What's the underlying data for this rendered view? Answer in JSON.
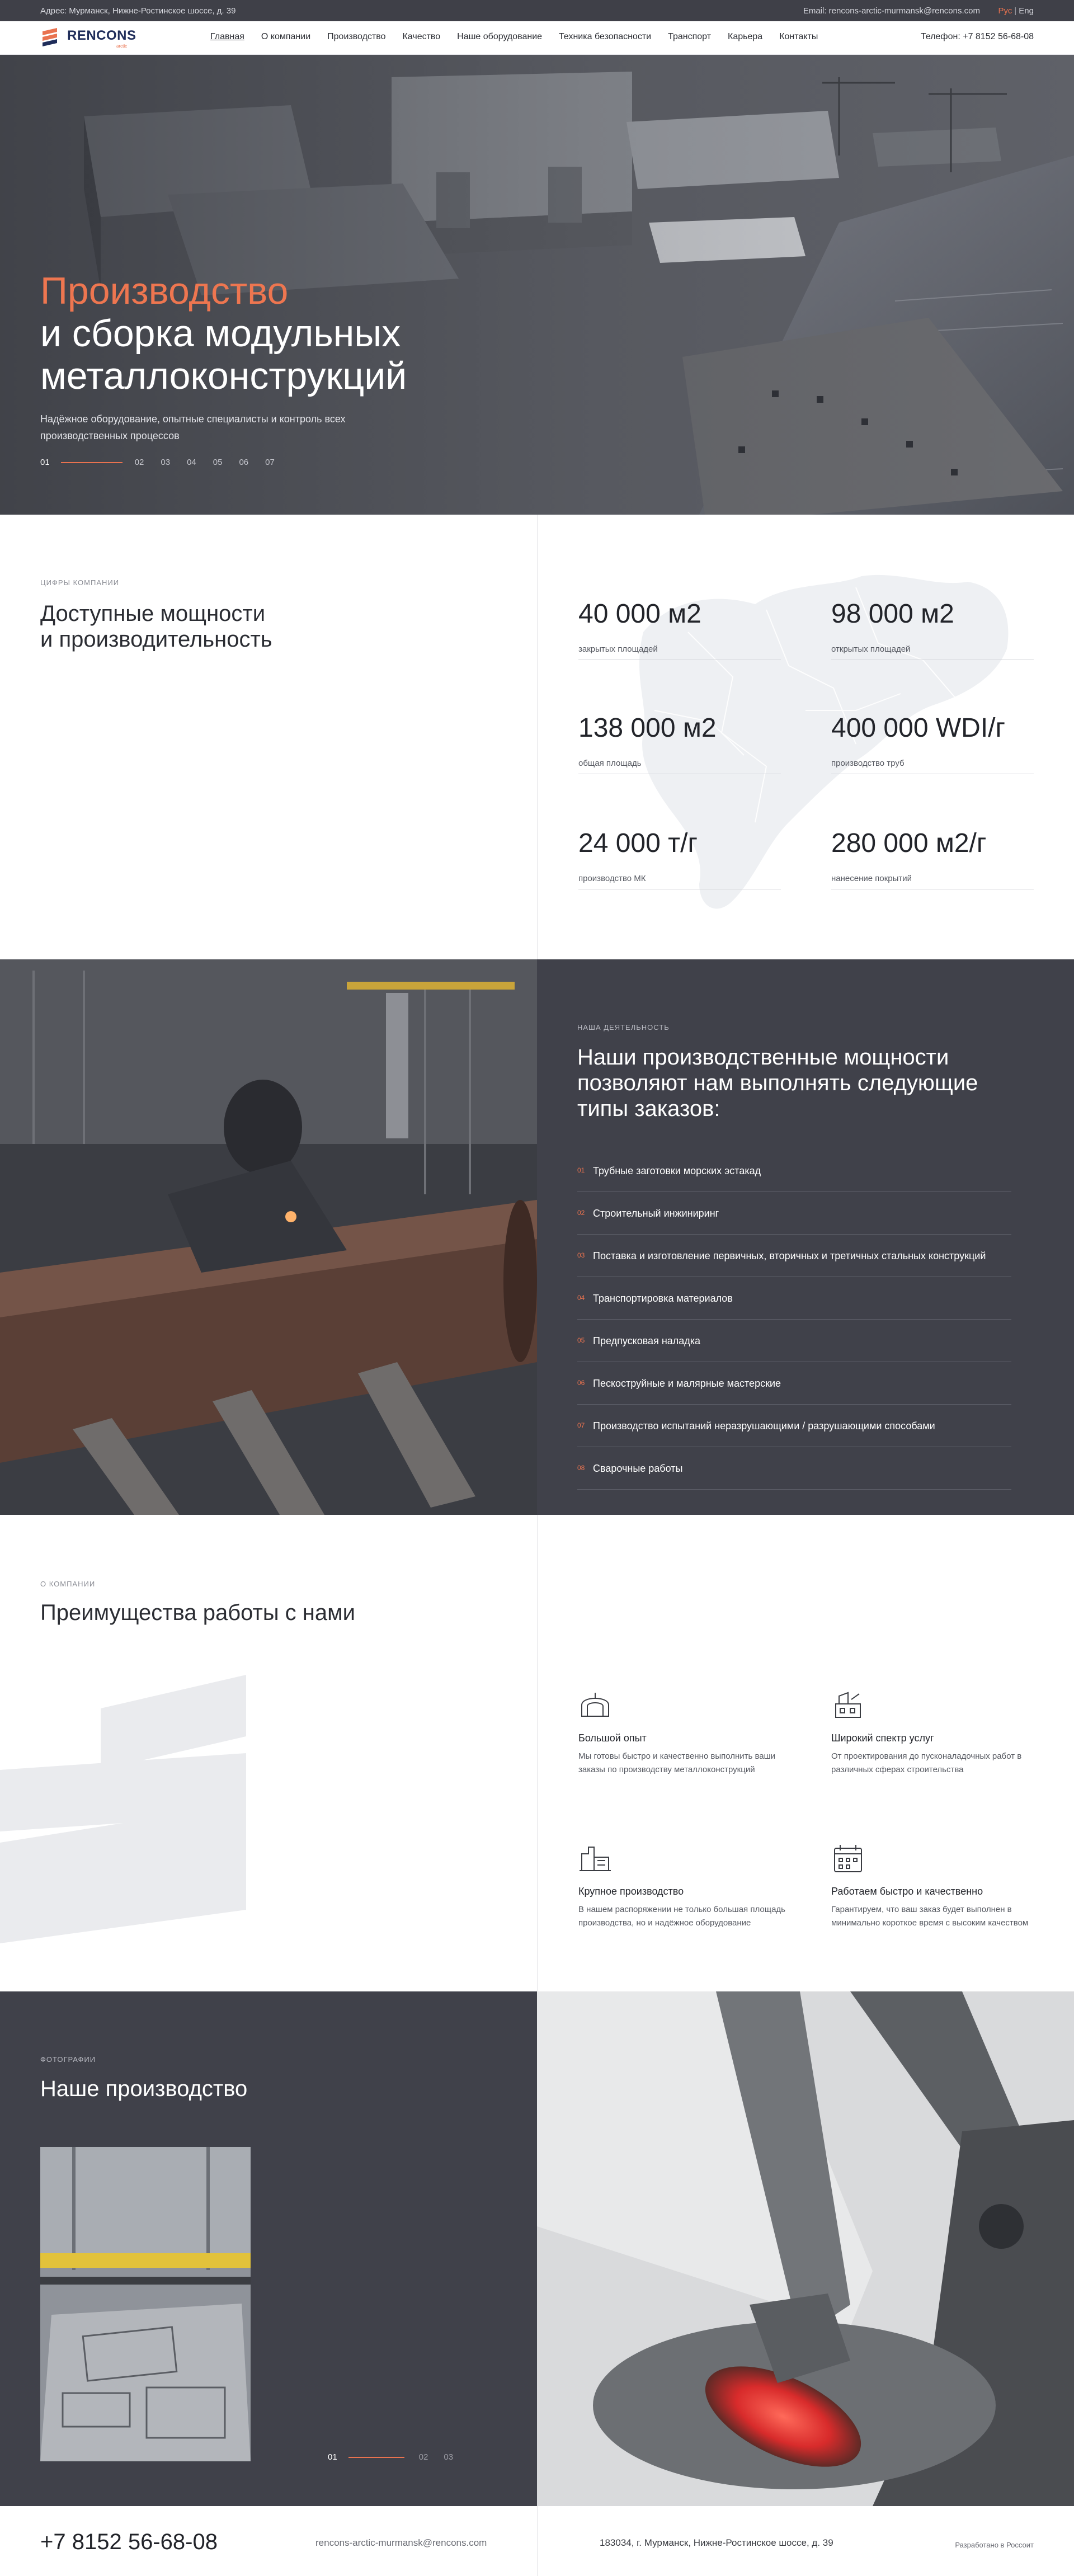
{
  "topbar": {
    "address": "Адрес: Мурманск, Нижне-Ростинское шоссе, д. 39",
    "email": "Email: rencons-arctic-murmansk@rencons.com",
    "lang_ru": "Рус",
    "lang_sep": "|",
    "lang_en": "Eng"
  },
  "header": {
    "logo_name": "RENCONS",
    "logo_sub": "arctic",
    "nav": [
      "Главная",
      "О компании",
      "Производство",
      "Качество",
      "Наше оборудование",
      "Техника безопасности",
      "Транспорт",
      "Карьера",
      "Контакты"
    ],
    "phone": "Телефон: +7 8152 56-68-08"
  },
  "hero": {
    "title_accent": "Производство",
    "title_line2": "и сборка модульных",
    "title_line3": "металлоконструкций",
    "subtitle": "Надёжное оборудование, опытные специалисты и контроль всех производственных процессов",
    "slides": [
      "01",
      "02",
      "03",
      "04",
      "05",
      "06",
      "07"
    ],
    "active_slide": "01"
  },
  "stats": {
    "eyebrow": "ЦИФРЫ КОМПАНИИ",
    "title_line1": "Доступные мощности",
    "title_line2": "и производительность",
    "items": [
      {
        "value": "40 000 м2",
        "label": "закрытых площадей"
      },
      {
        "value": "98 000 м2",
        "label": "открытых площадей"
      },
      {
        "value": "138 000 м2",
        "label": "общая площадь"
      },
      {
        "value": "400 000 WDI/г",
        "label": "производство труб"
      },
      {
        "value": "24 000 т/г",
        "label": "производство МК"
      },
      {
        "value": "280 000 м2/г",
        "label": "нанесение покрытий"
      }
    ]
  },
  "activity": {
    "eyebrow": "НАША ДЕЯТЕЛЬНОСТЬ",
    "title": "Наши производственные мощности позволяют нам выполнять следующие типы заказов:",
    "items": [
      {
        "n": "01",
        "text": "Трубные заготовки морских эстакад"
      },
      {
        "n": "02",
        "text": "Строительный инжиниринг"
      },
      {
        "n": "03",
        "text": "Поставка и изготовление первичных, вторичных и третичных стальных конструкций"
      },
      {
        "n": "04",
        "text": "Транспортировка материалов"
      },
      {
        "n": "05",
        "text": "Предпусковая наладка"
      },
      {
        "n": "06",
        "text": "Пескоструйные и малярные мастерские"
      },
      {
        "n": "07",
        "text": "Производство испытаний неразрушающими / разрушающими способами"
      },
      {
        "n": "08",
        "text": "Сварочные работы"
      }
    ]
  },
  "advantages": {
    "eyebrow": "О КОМПАНИИ",
    "title": "Преимущества работы с нами",
    "items": [
      {
        "icon": "arch-building-icon",
        "title": "Большой опыт",
        "desc": "Мы готовы быстро и качественно выполнить ваши заказы по производству металлоконструкций"
      },
      {
        "icon": "service-tools-icon",
        "title": "Широкий спектр услуг",
        "desc": "От проектирования до пусконаладочных работ в различных сферах строительства"
      },
      {
        "icon": "factory-icon",
        "title": "Крупное производство",
        "desc": "В нашем распоряжении не только большая площадь производства, но и надёжное оборудование"
      },
      {
        "icon": "calendar-icon",
        "title": "Работаем быстро и качественно",
        "desc": "Гарантируем, что ваш заказ будет выполнен в минимально короткое время с высоким качеством"
      }
    ]
  },
  "photos": {
    "eyebrow": "ФОТОГРАФИИ",
    "title": "Наше производство",
    "slides": [
      "01",
      "02",
      "03"
    ],
    "active_slide": "01"
  },
  "footer": {
    "phone": "+7 8152 56-68-08",
    "email": "rencons-arctic-murmansk@rencons.com",
    "address": "183034, г. Мурманск, Нижне-Ростинское шоссе, д. 39",
    "developer": "Разработано в Россоит"
  },
  "colors": {
    "accent": "#e9724f",
    "dark": "#40414a",
    "topbar": "#3f4048",
    "brand": "#1f2d5a"
  }
}
